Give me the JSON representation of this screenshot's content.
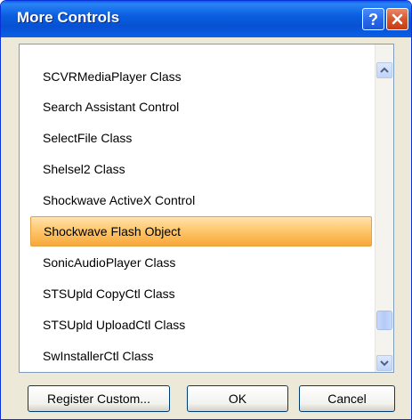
{
  "window": {
    "title": "More Controls"
  },
  "list": {
    "items": [
      {
        "label": "SCVRMediaPlayer Class"
      },
      {
        "label": "Search Assistant Control"
      },
      {
        "label": "SelectFile Class"
      },
      {
        "label": "Shelsel2 Class"
      },
      {
        "label": "Shockwave ActiveX Control"
      },
      {
        "label": "Shockwave Flash Object",
        "selected": true
      },
      {
        "label": "SonicAudioPlayer Class"
      },
      {
        "label": "STSUpld CopyCtl Class"
      },
      {
        "label": "STSUpld UploadCtl Class"
      },
      {
        "label": "SwInstallerCtl Class"
      }
    ]
  },
  "buttons": {
    "register_custom": "Register Custom...",
    "ok": "OK",
    "cancel": "Cancel"
  },
  "icons": {
    "help": "help-icon",
    "close": "close-icon",
    "scroll_up": "chevron-up-icon",
    "scroll_down": "chevron-down-icon"
  },
  "colors": {
    "titlebar": "#0a5fe0",
    "selection": "#ffc86e",
    "close_button": "#d9552c"
  }
}
